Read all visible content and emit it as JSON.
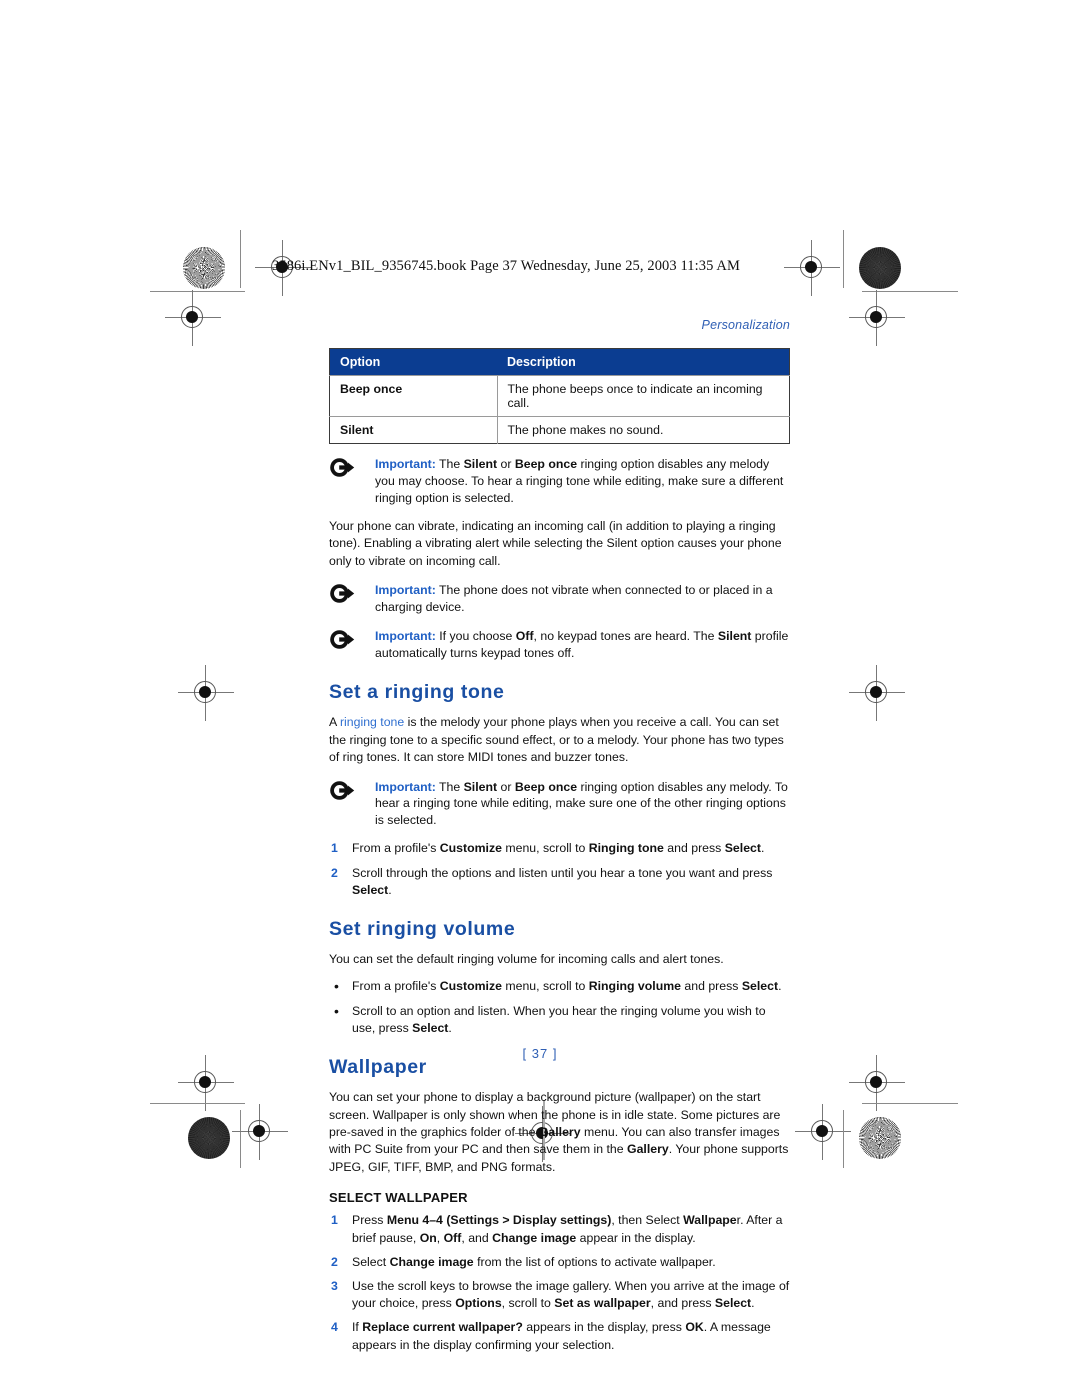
{
  "slug": {
    "text": "3586i.ENv1_BIL_9356745.book  Page 37  Wednesday, June 25, 2003  11:35 AM"
  },
  "running_head": "Personalization",
  "table": {
    "headers": [
      "Option",
      "Description"
    ],
    "rows": [
      [
        "Beep once",
        "The phone beeps once to indicate an incoming call."
      ],
      [
        "Silent",
        "The phone makes no sound."
      ]
    ]
  },
  "notes": {
    "note1_label": "Important:",
    "note1_text_a": " The ",
    "note1_b1": "Silent",
    "note1_text_b": " or ",
    "note1_b2": "Beep once",
    "note1_text_c": " ringing option disables any melody you may choose. To hear a ringing tone while editing, make sure a different ringing option is selected.",
    "note2_label": "Important:",
    "note2_text": " The phone does not vibrate when connected to or placed in a charging device.",
    "note3_label": "Important:",
    "note3_text_a": " If you choose ",
    "note3_b1": "Off",
    "note3_text_b": ", no keypad tones are heard. The ",
    "note3_b2": "Silent",
    "note3_text_c": " profile automatically turns keypad tones off.",
    "note4_label": "Important:",
    "note4_text_a": " The ",
    "note4_b1": "Silent",
    "note4_text_b": " or ",
    "note4_b2": "Beep once",
    "note4_text_c": " ringing option disables any melody. To hear a ringing tone while editing, make sure one of the other ringing options is selected."
  },
  "vibrate_para": "Your phone can vibrate, indicating an incoming call (in addition to playing a ringing tone). Enabling a vibrating alert while selecting the Silent option causes your phone only to vibrate on incoming call.",
  "section_ringing_tone": {
    "heading": "Set a ringing tone",
    "intro_a": "A ",
    "intro_term": "ringing tone",
    "intro_b": " is the melody your phone plays when you receive a call. You can set the ringing tone to a specific sound effect, or to a melody. Your phone has two types of ring tones. It can store MIDI tones and buzzer tones.",
    "steps": [
      {
        "num": "1",
        "parts": [
          "From a profile's ",
          "Customize",
          " menu, scroll to ",
          "Ringing tone",
          " and press ",
          "Select",
          "."
        ]
      },
      {
        "num": "2",
        "parts": [
          "Scroll through the options and listen until you hear a tone you want and press ",
          "Select",
          "."
        ]
      }
    ]
  },
  "section_ringing_volume": {
    "heading": "Set ringing volume",
    "intro": "You can set the default ringing volume for incoming calls and alert tones.",
    "bullets": [
      {
        "bullet": "•",
        "parts": [
          "From a profile's ",
          "Customize",
          " menu, scroll to ",
          "Ringing volume",
          " and press ",
          "Select",
          "."
        ]
      },
      {
        "bullet": "•",
        "parts": [
          "Scroll to an option and listen. When you hear the ringing volume you wish to use, press ",
          "Select",
          "."
        ]
      }
    ]
  },
  "section_wallpaper": {
    "heading": "Wallpaper",
    "intro_a": "You can set your phone to display a background picture (wallpaper) on the start screen. Wallpaper is only shown when the phone is in idle state. Some pictures are pre-saved in the graphics folder of the ",
    "intro_b1": "Gallery",
    "intro_b": " menu. You can also transfer images with PC Suite from your PC and then save them in the ",
    "intro_b2": "Gallery",
    "intro_c": ". Your phone supports JPEG, GIF, TIFF, BMP, and PNG formats.",
    "subheading": "SELECT WALLPAPER",
    "steps": [
      {
        "num": "1",
        "parts": [
          "Press ",
          "Menu 4–4 (Settings > Display settings)",
          ", then Select ",
          "Wallpape",
          "r. After a brief pause, ",
          "On",
          ", ",
          "Off",
          ", and ",
          "Change image",
          " appear in the display."
        ]
      },
      {
        "num": "2",
        "parts": [
          "Select ",
          "Change image",
          " from the list of options to activate wallpaper."
        ]
      },
      {
        "num": "3",
        "parts": [
          "Use the scroll keys to browse the image gallery. When you arrive at the image of your choice, press ",
          "Options",
          ", scroll to ",
          "Set as wallpaper",
          ", and press ",
          "Select",
          "."
        ]
      },
      {
        "num": "4",
        "parts": [
          "If ",
          "Replace current wallpaper?",
          " appears in the display, press ",
          "OK",
          ". A message appears in the display confirming your selection."
        ]
      }
    ]
  },
  "folio": "[ 37 ]",
  "colors": {
    "table_header_bg": "#0b3d91",
    "heading_blue": "#1a4fa3",
    "accent_blue": "#1f5fc4",
    "running_head_blue": "#2f5fb4"
  }
}
